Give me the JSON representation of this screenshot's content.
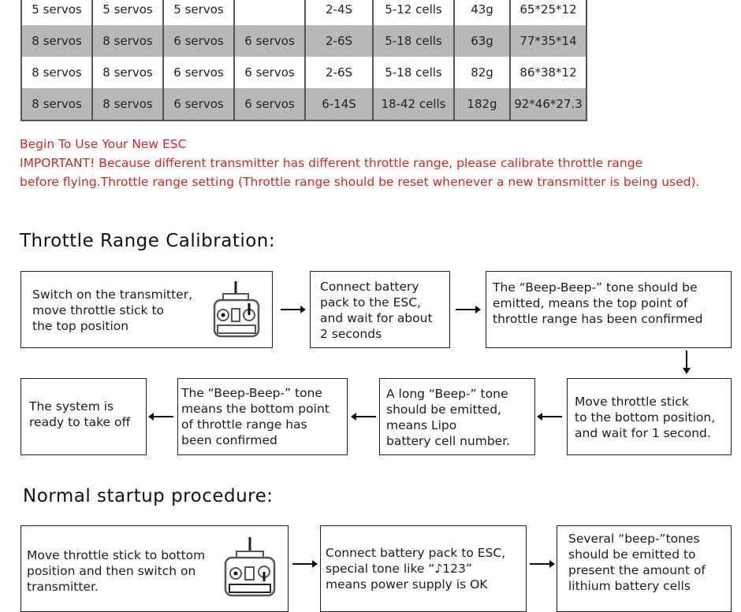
{
  "spec_table": {
    "rows": [
      {
        "shade": "white",
        "cells": [
          "5 servos",
          "5 servos",
          "5 servos",
          "",
          "2-4S",
          "5-12 cells",
          "43g",
          "65*25*12"
        ]
      },
      {
        "shade": "gray",
        "cells": [
          "8 servos",
          "8 servos",
          "6 servos",
          "6 servos",
          "2-6S",
          "5-18 cells",
          "63g",
          "77*35*14"
        ]
      },
      {
        "shade": "white",
        "cells": [
          "8 servos",
          "8 servos",
          "6 servos",
          "6 servos",
          "2-6S",
          "5-18 cells",
          "82g",
          "86*38*12"
        ]
      },
      {
        "shade": "gray",
        "cells": [
          "8 servos",
          "8 servos",
          "6 servos",
          "6 servos",
          "6-14S",
          "18-42 cells",
          "182g",
          "92*46*27.3"
        ]
      }
    ]
  },
  "notice": {
    "title": "Begin To Use Your New ESC",
    "line1": "IMPORTANT!  Because different transmitter has different throttle range, please calibrate throttle range",
    "line2": "before flying.Throttle range setting (Throttle range should be reset whenever a new transmitter is being used).",
    "color": "#d0281e"
  },
  "calibration": {
    "heading": "Throttle Range Calibration:",
    "steps": [
      {
        "text": "Switch on the transmitter,\nmove throttle stick to\nthe top position",
        "icon": "transmitter-stick-up-icon"
      },
      {
        "text": "Connect battery\npack to the ESC,\nand wait for about\n2 seconds"
      },
      {
        "text": "The “Beep-Beep-” tone should be\nemitted, means the top point of\nthrottle range has been confirmed"
      },
      {
        "text": "Move throttle stick\nto the bottom position,\nand wait for 1 second."
      },
      {
        "text": "A long “Beep-” tone\nshould be emitted,\nmeans Lipo\nbattery cell number."
      },
      {
        "text": "The “Beep-Beep-” tone\nmeans the bottom point\nof throttle range has\nbeen confirmed"
      },
      {
        "text": "The system is\nready to take off"
      }
    ]
  },
  "startup": {
    "heading": "Normal startup procedure:",
    "steps": [
      {
        "text": "Move throttle stick to bottom\nposition and then switch on\ntransmitter.",
        "icon": "transmitter-stick-down-icon"
      },
      {
        "text_pre": "Connect battery pack to ESC,\nspecial tone like “",
        "note_glyph": "♪",
        "text_post": "123”\nmeans power supply is OK"
      },
      {
        "text": "Several “beep-”tones\nshould be emitted to\npresent the amount of\nlithium battery cells"
      }
    ]
  }
}
